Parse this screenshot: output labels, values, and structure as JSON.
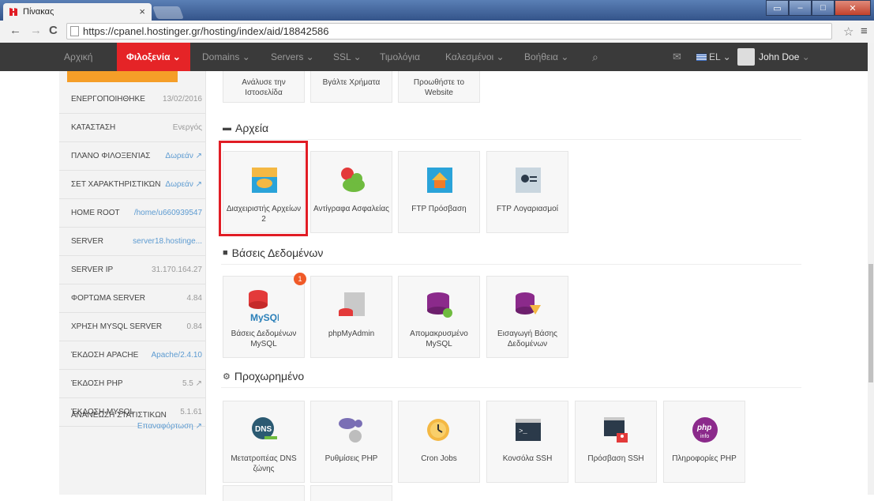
{
  "browser": {
    "tab_title": "Πίνακας",
    "tab_close": "×",
    "url": "https://cpanel.hostinger.gr/hosting/index/aid/18842586"
  },
  "nav": {
    "items": [
      "Αρχική",
      "Φιλοξενία",
      "Domains",
      "Servers",
      "SSL",
      "Τιμολόγια",
      "Καλεσμένοι",
      "Βοήθεια"
    ],
    "lang": "EL",
    "user": "John Doe"
  },
  "sidebar": {
    "rows": [
      {
        "k": "ΕΝΕΡΓΟΠΟΙΗΘΗΚΕ",
        "v": "13/02/2016"
      },
      {
        "k": "ΚΑΤΑΣΤΑΣΗ",
        "v": "Ενεργός"
      },
      {
        "k": "ΠΛΆΝΟ ΦΙΛΟΞΕΝΊΑΣ",
        "v": "Δωρεάν ↗"
      },
      {
        "k": "ΣΕΤ ΧΑΡΑΚΤΗΡΙΣΤΙΚΏΝ",
        "v": "Δωρεάν ↗"
      },
      {
        "k": "HOME ROOT",
        "v": "/home/u660939547"
      },
      {
        "k": "SERVER",
        "v": "server18.hostinge..."
      },
      {
        "k": "SERVER IP",
        "v": "31.170.164.27"
      },
      {
        "k": "ΦΟΡΤΩΜΑ SERVER",
        "v": "4.84"
      },
      {
        "k": "ΧΡΗΣΗ MYSQL SERVER",
        "v": "0.84"
      },
      {
        "k": "ΈΚΔΟΣΗ APACHE",
        "v": "Apache/2.4.10"
      },
      {
        "k": "ΈΚΔΟΣΗ PHP",
        "v": "5.5 ↗"
      },
      {
        "k": "ΈΚΔΟΣΗ MYSQL",
        "v": "5.1.61"
      }
    ],
    "stats_label": "ΑΝΑΝΕΩΣΗ ΣΤΑΤΙΣΤΙΚΩΝ",
    "stats_link": "Επαναφόρτωση ↗"
  },
  "top_partial": [
    "Ανάλυσε την Ιστοσελίδα",
    "Βγάλτε Χρήματα",
    "Προωθήστε το Website"
  ],
  "sections": {
    "files": {
      "title": "Αρχεία",
      "tiles": [
        "Διαχειριστής Αρχείων 2",
        "Αντίγραφα Ασφαλείας",
        "FTP Πρόσβαση",
        "FTP Λογαριασμοί"
      ]
    },
    "db": {
      "title": "Βάσεις Δεδομένων",
      "badge": "1",
      "mysql_word": "MySQL",
      "tiles": [
        "Βάσεις Δεδομένων MySQL",
        "phpMyAdmin",
        "Απομακρυσμένο MySQL",
        "Εισαγωγή Βάσης Δεδομένων"
      ]
    },
    "advanced": {
      "title": "Προχωρημένο",
      "dns_word": "DNS",
      "php_word": "php",
      "info_word": "info",
      "tiles": [
        "Μετατροπέας DNS ζώνης",
        "Ρυθμίσεις PHP",
        "Cron Jobs",
        "Κονσόλα SSH",
        "Πρόσβαση SSH",
        "Πληροφορίες PHP"
      ]
    }
  }
}
